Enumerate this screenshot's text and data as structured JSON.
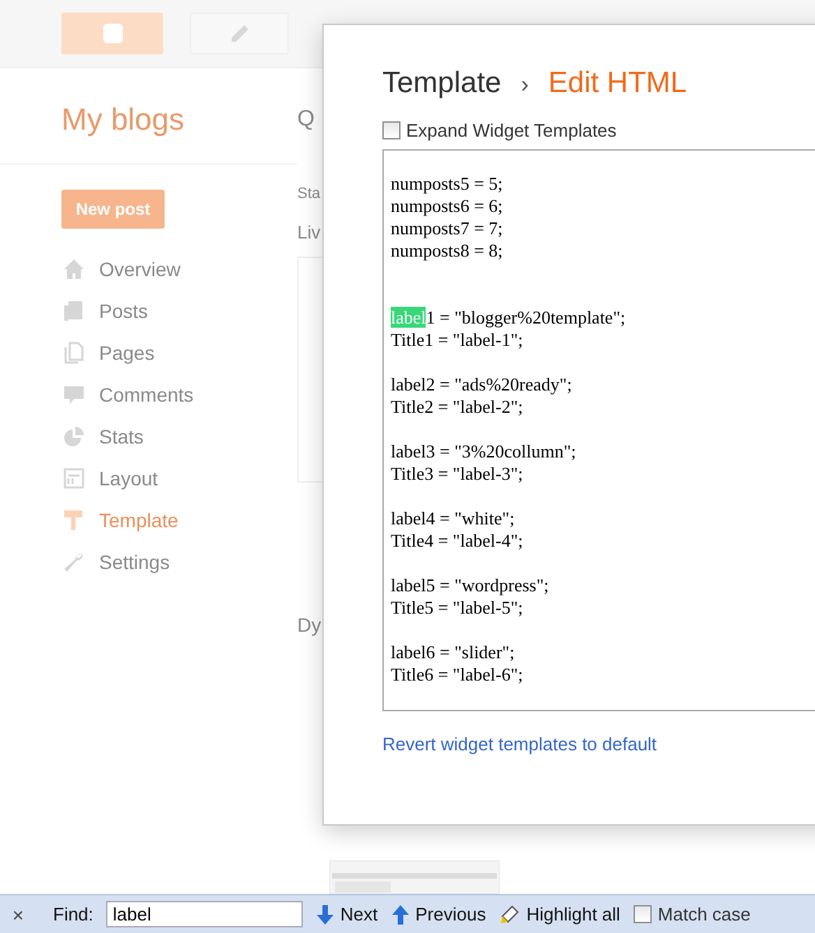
{
  "header": {
    "buttons": [
      {
        "kind": "logo"
      },
      {
        "kind": "pencil"
      }
    ]
  },
  "sidebar": {
    "title": "My blogs",
    "new_post": "New post",
    "items": [
      {
        "label": "Overview",
        "selected": false
      },
      {
        "label": "Posts",
        "selected": false
      },
      {
        "label": "Pages",
        "selected": false
      },
      {
        "label": "Comments",
        "selected": false
      },
      {
        "label": "Stats",
        "selected": false
      },
      {
        "label": "Layout",
        "selected": false
      },
      {
        "label": "Template",
        "selected": true
      },
      {
        "label": "Settings",
        "selected": false
      }
    ]
  },
  "content": {
    "heading": "Q",
    "status": "Sta",
    "live": "Liv",
    "dynamic": "Dy"
  },
  "dialog": {
    "breadcrumb": "Template",
    "separator": "›",
    "title": "Edit HTML",
    "expand": {
      "label": "Expand Widget Templates",
      "checked": false
    },
    "code_blocks": [
      [
        "numposts5 = 5;",
        "numposts6 = 6;",
        "numposts7 = 7;",
        "numposts8 = 8;"
      ],
      [
        {
          "match": "label",
          "text": "1 = \"blogger%20template\";"
        },
        "Title1 = \"label-1\";"
      ],
      [
        "label2 = \"ads%20ready\";",
        "Title2 = \"label-2\";"
      ],
      [
        "label3 = \"3%20collumn\";",
        "Title3 = \"label-3\";"
      ],
      [
        "label4 = \"white\";",
        "Title4 = \"label-4\";"
      ],
      [
        "label5 = \"wordpress\";",
        "Title5 = \"label-5\";"
      ],
      [
        "label6 = \"slider\";",
        "Title6 = \"label-6\";"
      ]
    ],
    "revert_link": "Revert widget templates to default"
  },
  "find_bar": {
    "close": "×",
    "label": "Find:",
    "value": "label",
    "next": "Next",
    "previous": "Previous",
    "highlight_all": "Highlight all",
    "match_case": {
      "label": "Match case",
      "checked": false
    }
  }
}
